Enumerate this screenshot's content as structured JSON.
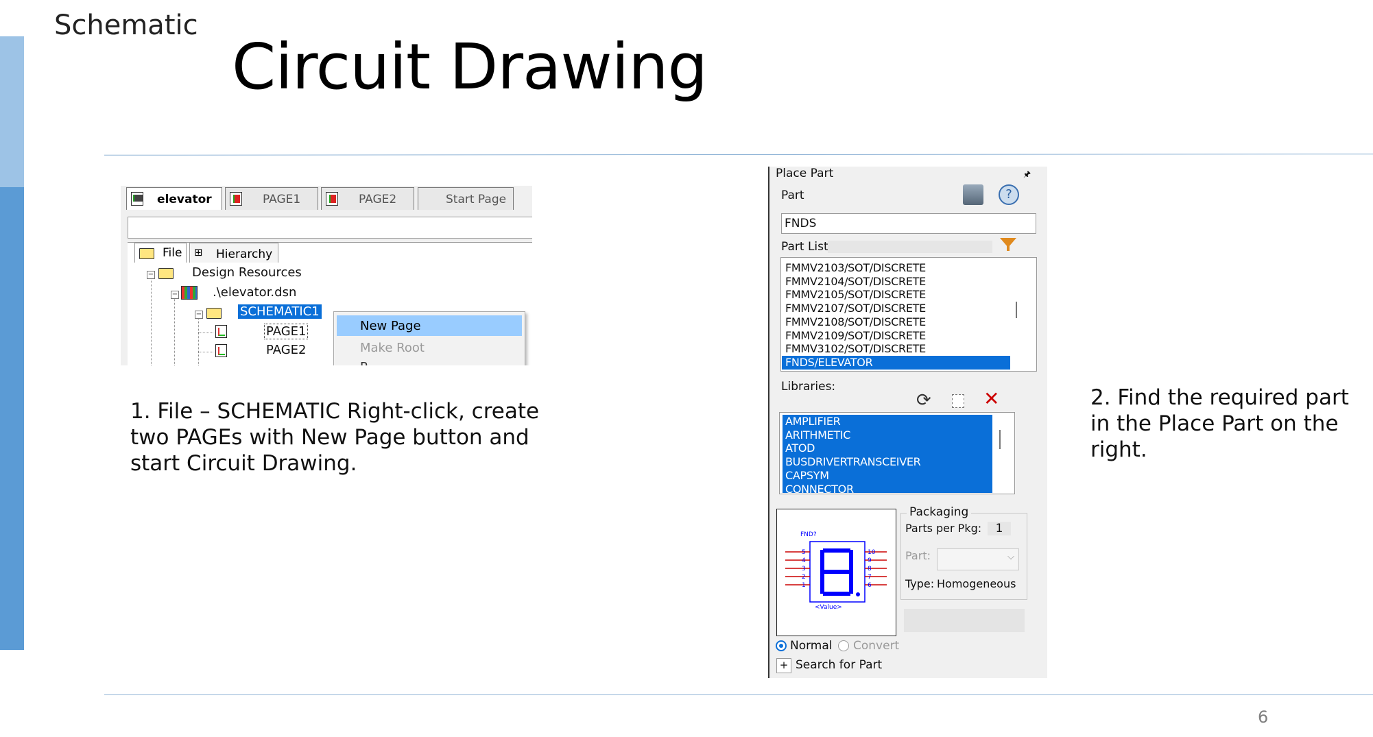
{
  "slide": {
    "section": "Schematic",
    "title": "Circuit Drawing",
    "page_number": "6",
    "caption_left": "1. File – SCHEMATIC Right-click, create two PAGEs with New Page button and start Circuit Drawing.",
    "caption_right": "2. Find the required part in the Place Part on the right."
  },
  "project_window": {
    "tabs": [
      "elevator",
      "PAGE1",
      "PAGE2",
      "Start Page"
    ],
    "subtabs": [
      "File",
      "Hierarchy"
    ],
    "tree": {
      "root": "Design Resources",
      "design_file": ".\\elevator.dsn",
      "schematic": "SCHEMATIC1",
      "pages": [
        "PAGE1",
        "PAGE2"
      ]
    },
    "context_menu": {
      "items": [
        "New Page",
        "Make Root",
        "P"
      ],
      "highlighted": "New Page"
    }
  },
  "place_part": {
    "title": "Place Part",
    "pin_glyph": "🖈",
    "part_label": "Part",
    "part_value": "FNDS",
    "part_list_label": "Part List:",
    "part_list": [
      "FMMV2103/SOT/DISCRETE",
      "FMMV2104/SOT/DISCRETE",
      "FMMV2105/SOT/DISCRETE",
      "FMMV2107/SOT/DISCRETE",
      "FMMV2108/SOT/DISCRETE",
      "FMMV2109/SOT/DISCRETE",
      "FMMV3102/SOT/DISCRETE",
      "FNDS/ELEVATOR"
    ],
    "part_list_selected": "FNDS/ELEVATOR",
    "libraries_label": "Libraries:",
    "libraries": [
      "AMPLIFIER",
      "ARITHMETIC",
      "ATOD",
      "BUSDRIVERTRANSCEIVER",
      "CAPSYM",
      "CONNECTOR"
    ],
    "preview": {
      "ref": "FND?",
      "value": "<Value>",
      "left_pins": [
        "5",
        "4",
        "3",
        "2",
        "1"
      ],
      "right_pins": [
        "10",
        "9",
        "8",
        "7",
        "6"
      ],
      "colors": {
        "body": "#0000ff",
        "pins": "#cc0000"
      }
    },
    "packaging": {
      "label": "Packaging",
      "parts_per_pkg_label": "Parts per Pkg:",
      "parts_per_pkg": "1",
      "part_label": "Part:",
      "type_label": "Type:",
      "type_value": "Homogeneous"
    },
    "view_options": {
      "normal": "Normal",
      "convert": "Convert",
      "selected": "Normal"
    },
    "search_label": "Search for Part",
    "search_toggle": "+"
  },
  "colors": {
    "sidebar_light": "#9dc3e6",
    "sidebar_dark": "#5b9bd5",
    "selection": "#0a6fd8",
    "menu_highlight": "#99ccff"
  }
}
